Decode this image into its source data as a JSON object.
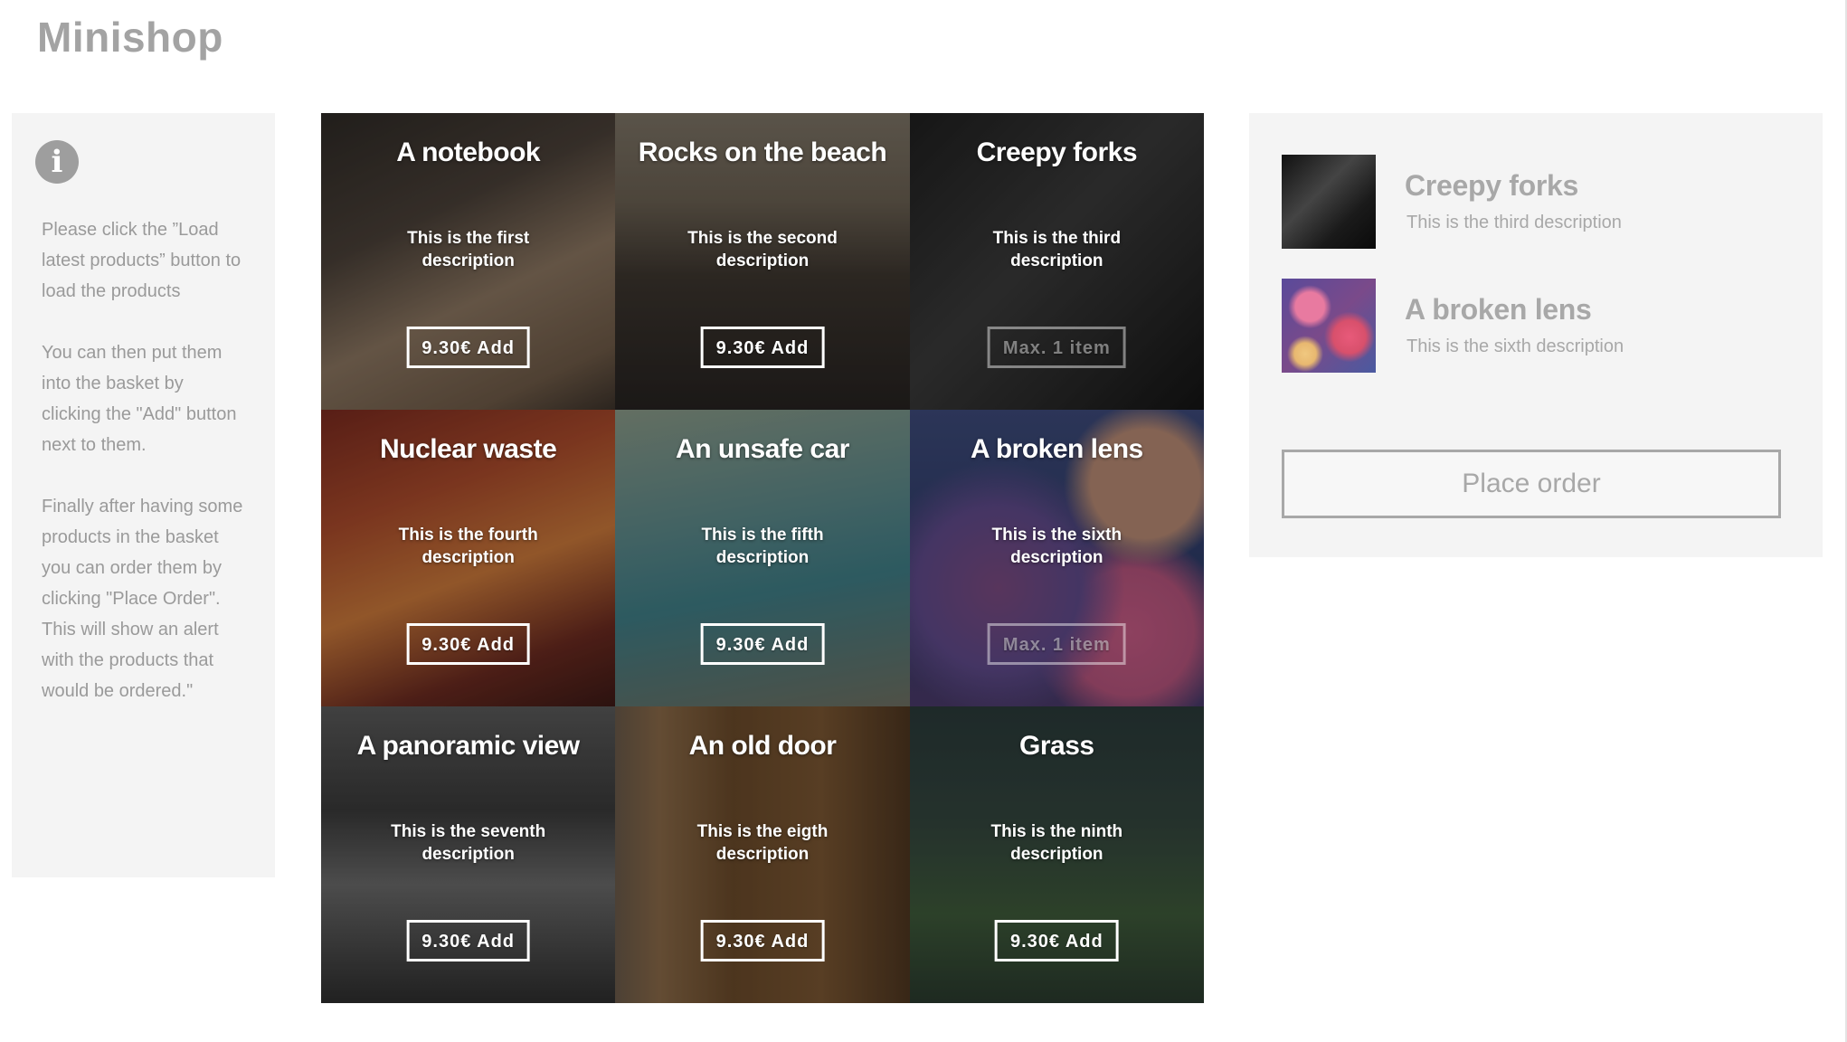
{
  "app": {
    "title": "Minishop"
  },
  "info": {
    "icon": "info-icon",
    "paragraphs": [
      "Please click the ”Load latest products” button to load the products",
      "You can then put them into the basket by clicking the \"Add\" button next to them.",
      "Finally after having some products in the basket you can order them by clicking \"Place Order\". This will show an alert with the products that would be ordered.\""
    ]
  },
  "products": [
    {
      "title": "A notebook",
      "description": "This is the first description",
      "button": "9.30€ Add",
      "disabled": false
    },
    {
      "title": "Rocks on the beach",
      "description": "This is the second description",
      "button": "9.30€ Add",
      "disabled": false
    },
    {
      "title": "Creepy forks",
      "description": "This is the third description",
      "button": "Max. 1 item",
      "disabled": true
    },
    {
      "title": "Nuclear waste",
      "description": "This is the fourth description",
      "button": "9.30€ Add",
      "disabled": false
    },
    {
      "title": "An unsafe car",
      "description": "This is the fifth description",
      "button": "9.30€ Add",
      "disabled": false
    },
    {
      "title": "A broken lens",
      "description": "This is the sixth description",
      "button": "Max. 1 item",
      "disabled": true
    },
    {
      "title": "A panoramic view",
      "description": "This is the seventh description",
      "button": "9.30€ Add",
      "disabled": false
    },
    {
      "title": "An old door",
      "description": "This is the eigth description",
      "button": "9.30€ Add",
      "disabled": false
    },
    {
      "title": "Grass",
      "description": "This is the ninth description",
      "button": "9.30€ Add",
      "disabled": false
    }
  ],
  "basket": {
    "items": [
      {
        "name": "Creepy forks",
        "description": "This is the third description"
      },
      {
        "name": "A broken lens",
        "description": "This is the sixth description"
      }
    ],
    "place_order_label": "Place order"
  },
  "colors": {
    "muted_text": "#a3a3a3",
    "panel_bg": "#f4f4f4",
    "button_border": "#ffffff"
  }
}
